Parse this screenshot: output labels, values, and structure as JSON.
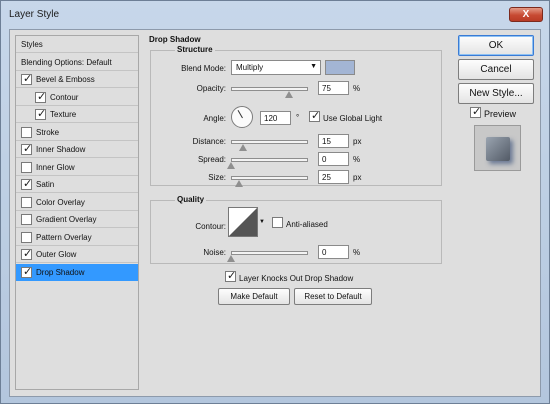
{
  "window": {
    "title": "Layer Style",
    "close_label": "X"
  },
  "sidebar": {
    "header": "Styles",
    "items": [
      {
        "label": "Blending Options: Default",
        "checkable": false,
        "checked": false,
        "indent": false,
        "selected": false
      },
      {
        "label": "Bevel & Emboss",
        "checkable": true,
        "checked": true,
        "indent": false,
        "selected": false
      },
      {
        "label": "Contour",
        "checkable": true,
        "checked": true,
        "indent": true,
        "selected": false
      },
      {
        "label": "Texture",
        "checkable": true,
        "checked": true,
        "indent": true,
        "selected": false
      },
      {
        "label": "Stroke",
        "checkable": true,
        "checked": false,
        "indent": false,
        "selected": false
      },
      {
        "label": "Inner Shadow",
        "checkable": true,
        "checked": true,
        "indent": false,
        "selected": false
      },
      {
        "label": "Inner Glow",
        "checkable": true,
        "checked": false,
        "indent": false,
        "selected": false
      },
      {
        "label": "Satin",
        "checkable": true,
        "checked": true,
        "indent": false,
        "selected": false
      },
      {
        "label": "Color Overlay",
        "checkable": true,
        "checked": false,
        "indent": false,
        "selected": false
      },
      {
        "label": "Gradient Overlay",
        "checkable": true,
        "checked": false,
        "indent": false,
        "selected": false
      },
      {
        "label": "Pattern Overlay",
        "checkable": true,
        "checked": false,
        "indent": false,
        "selected": false
      },
      {
        "label": "Outer Glow",
        "checkable": true,
        "checked": true,
        "indent": false,
        "selected": false
      },
      {
        "label": "Drop Shadow",
        "checkable": true,
        "checked": true,
        "indent": false,
        "selected": true
      }
    ]
  },
  "drop_shadow": {
    "title": "Drop Shadow",
    "structure": {
      "title": "Structure",
      "blend_mode_label": "Blend Mode:",
      "blend_mode_value": "Multiply",
      "shadow_color": "#a3b5d4",
      "opacity_label": "Opacity:",
      "opacity_value": "75",
      "opacity_unit": "%",
      "opacity_fraction": 0.75,
      "angle_label": "Angle:",
      "angle_value": "120",
      "angle_unit": "°",
      "use_global_light_label": "Use Global Light",
      "use_global_light_checked": true,
      "distance_label": "Distance:",
      "distance_value": "15",
      "distance_unit": "px",
      "distance_fraction": 0.15,
      "spread_label": "Spread:",
      "spread_value": "0",
      "spread_unit": "%",
      "spread_fraction": 0,
      "size_label": "Size:",
      "size_value": "25",
      "size_unit": "px",
      "size_fraction": 0.1
    },
    "quality": {
      "title": "Quality",
      "contour_label": "Contour:",
      "anti_aliased_label": "Anti-aliased",
      "anti_aliased_checked": false,
      "noise_label": "Noise:",
      "noise_value": "0",
      "noise_unit": "%",
      "noise_fraction": 0
    },
    "knockout_label": "Layer Knocks Out Drop Shadow",
    "knockout_checked": true,
    "make_default_label": "Make Default",
    "reset_default_label": "Reset to Default"
  },
  "actions": {
    "ok_label": "OK",
    "cancel_label": "Cancel",
    "new_style_label": "New Style...",
    "preview_label": "Preview",
    "preview_checked": true
  }
}
